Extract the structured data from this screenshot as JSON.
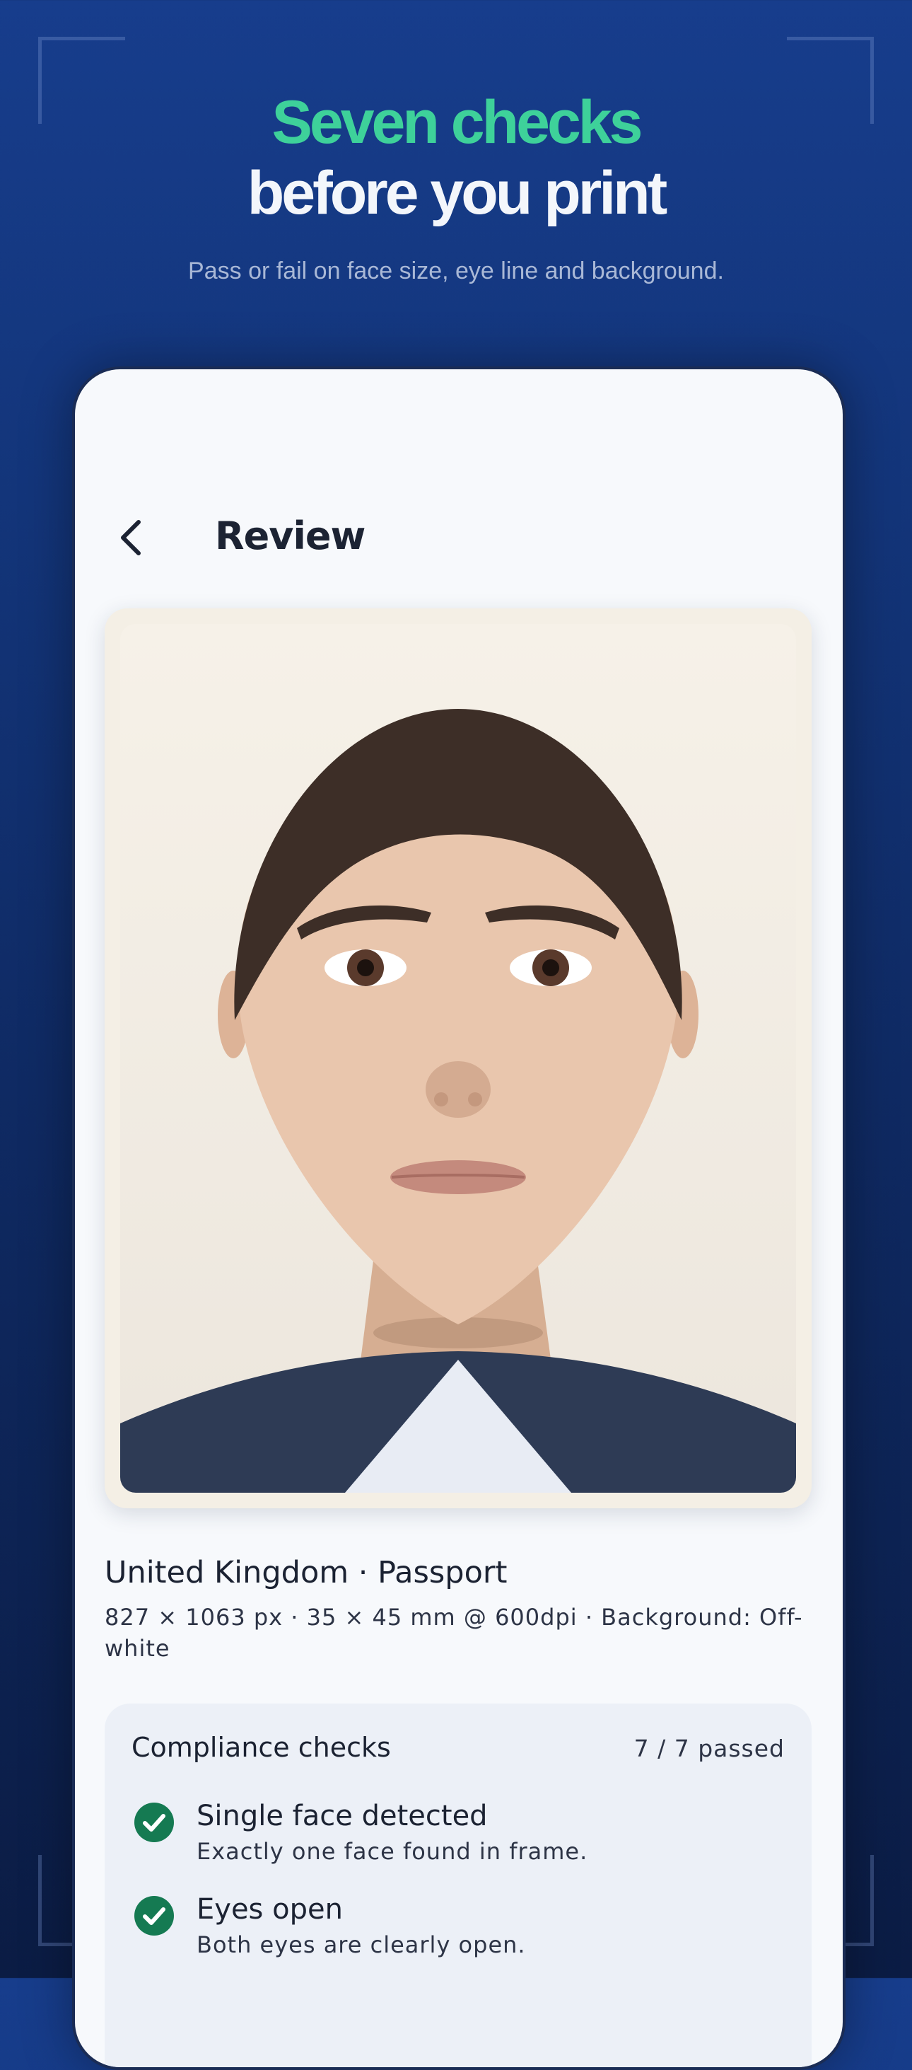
{
  "headline": {
    "line1": "Seven checks",
    "line2": "before you print",
    "subtitle": "Pass or fail on face size, eye line and background."
  },
  "screen": {
    "title": "Review",
    "document": {
      "title": "United Kingdom · Passport",
      "meta": "827 × 1063 px · 35 × 45 mm @ 600dpi · Background: Off-white"
    },
    "checks": {
      "heading": "Compliance checks",
      "summary": "7 / 7 passed",
      "items": [
        {
          "label": "Single face detected",
          "description": "Exactly one face found in frame."
        },
        {
          "label": "Eyes open",
          "description": "Both eyes are clearly open."
        }
      ]
    }
  },
  "icons": {
    "back": "chevron-left-icon",
    "check": "check-circle-icon"
  },
  "colors": {
    "accent_green": "#3ed19a",
    "pass_green": "#157a52",
    "background_navy": "#13357a"
  }
}
